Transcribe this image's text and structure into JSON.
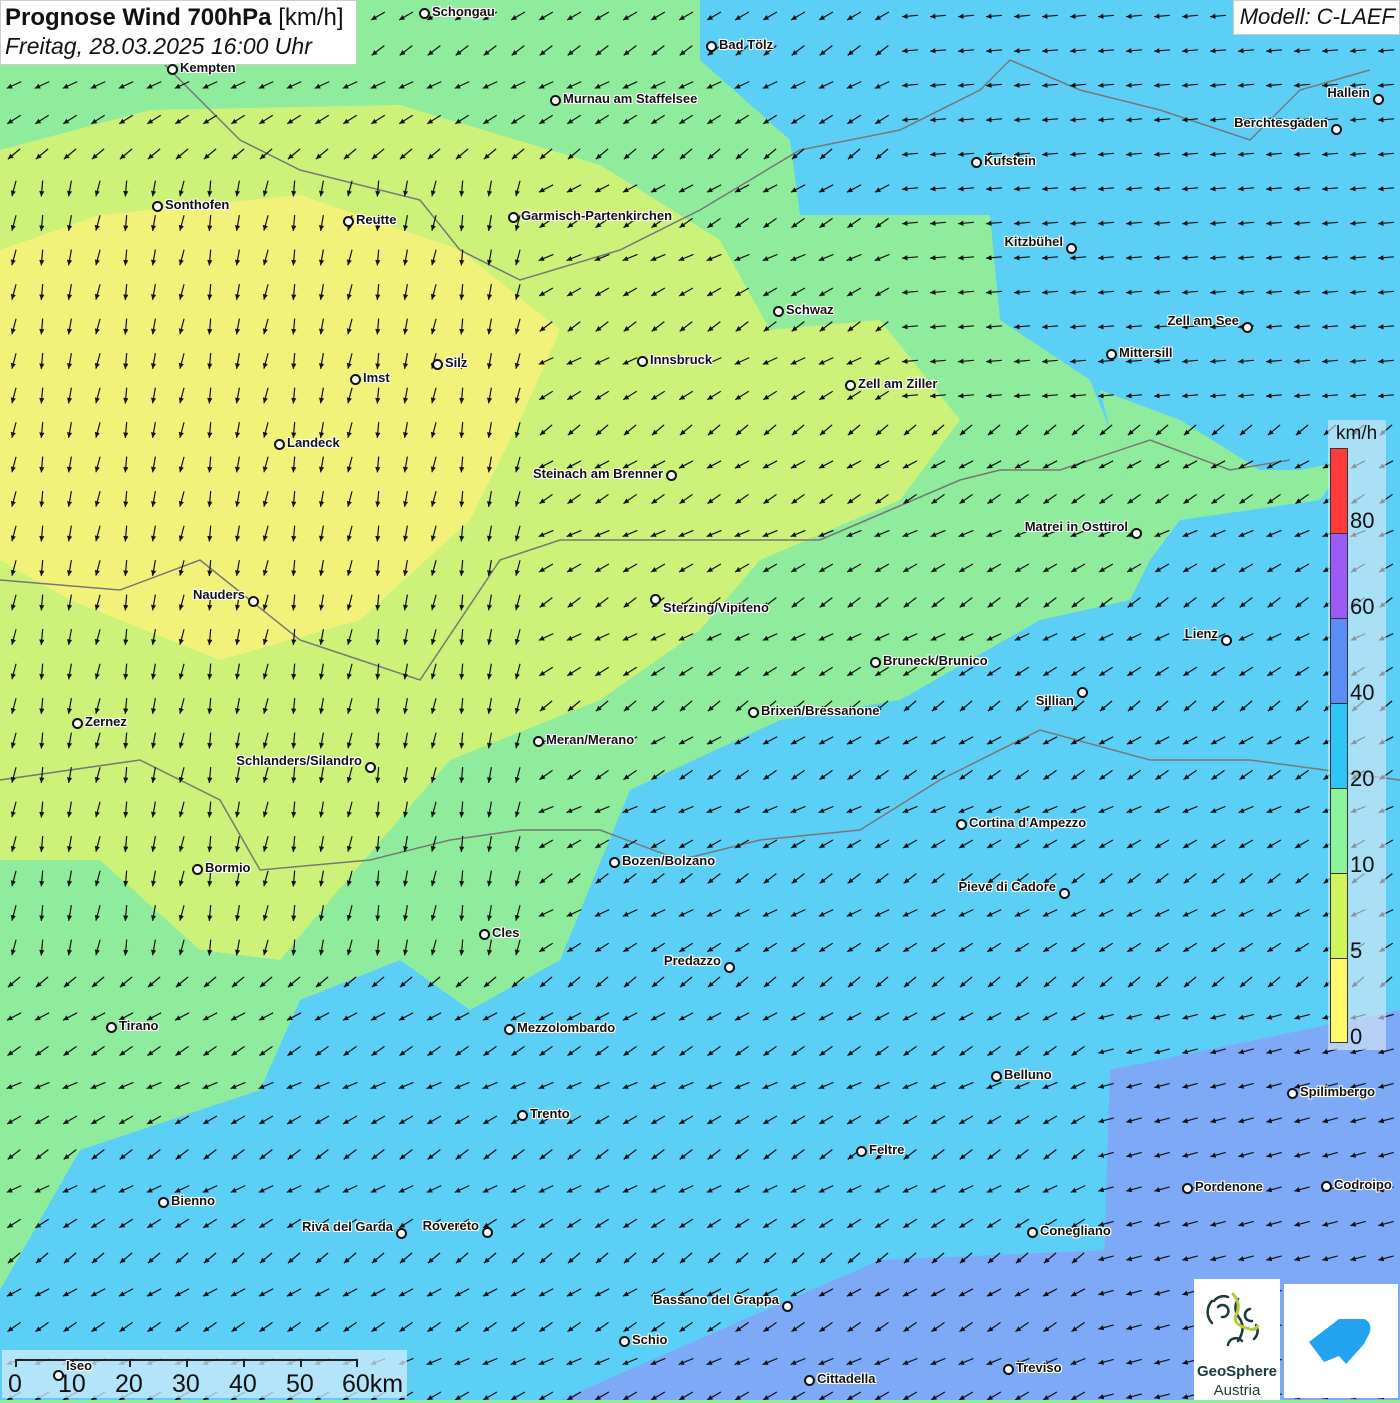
{
  "header": {
    "title": "Prognose Wind 700hPa",
    "unit": "[km/h]",
    "datetime": "Freitag, 28.03.2025 16:00 Uhr",
    "model": "Modell: C-LAEF"
  },
  "legend": {
    "unit": "km/h",
    "ticks": [
      "80",
      "60",
      "40",
      "20",
      "10",
      "5",
      "0"
    ],
    "colors": [
      "#ff3a3a",
      "#9a5cf5",
      "#5b8ef5",
      "#2ec6f5",
      "#8af59a",
      "#cff55a",
      "#fff86a"
    ]
  },
  "scale_bar": {
    "labels": [
      "0",
      "10",
      "20",
      "30",
      "40",
      "50",
      "60km"
    ]
  },
  "logos": {
    "geosphere_line1": "GeoSphere",
    "geosphere_line2": "Austria"
  },
  "colors": {
    "yellow": "#f2f27a",
    "yellowgreen": "#cdf27a",
    "green": "#8fec9c",
    "blue": "#5ccff7",
    "darkblue": "#7ea9f7"
  },
  "cities": [
    "Schongau",
    "Bad Tölz",
    "Kempten",
    "Murnau am Staffelsee",
    "Hallein",
    "Berchtesgaden",
    "Kufstein",
    "Sonthofen",
    "Reutte",
    "Garmisch-Partenkirchen",
    "Kitzbühel",
    "Schwaz",
    "Zell am See",
    "Mittersill",
    "Silz",
    "Innsbruck",
    "Imst",
    "Zell am Ziller",
    "Landeck",
    "Steinach am Brenner",
    "Matrei in Osttirol",
    "Nauders",
    "Sterzing/Vipiteno",
    "Lienz",
    "Bruneck/Brunico",
    "Sillian",
    "Brixen/Bressanone",
    "Zernez",
    "Meran/Merano",
    "Schlanders/Silandro",
    "Cortina d'Ampezzo",
    "Bozen/Bolzano",
    "Bormio",
    "Pieve di Cadore",
    "Cles",
    "Predazzo",
    "Tirano",
    "Mezzolombardo",
    "Belluno",
    "Spilimbergo",
    "Trento",
    "Feltre",
    "Pordenone",
    "Codroipo",
    "Bienno",
    "Riva del Garda",
    "Rovereto",
    "Conegliano",
    "Bassano del Grappa",
    "Schio",
    "Treviso",
    "Cittadella",
    "Iseo"
  ]
}
